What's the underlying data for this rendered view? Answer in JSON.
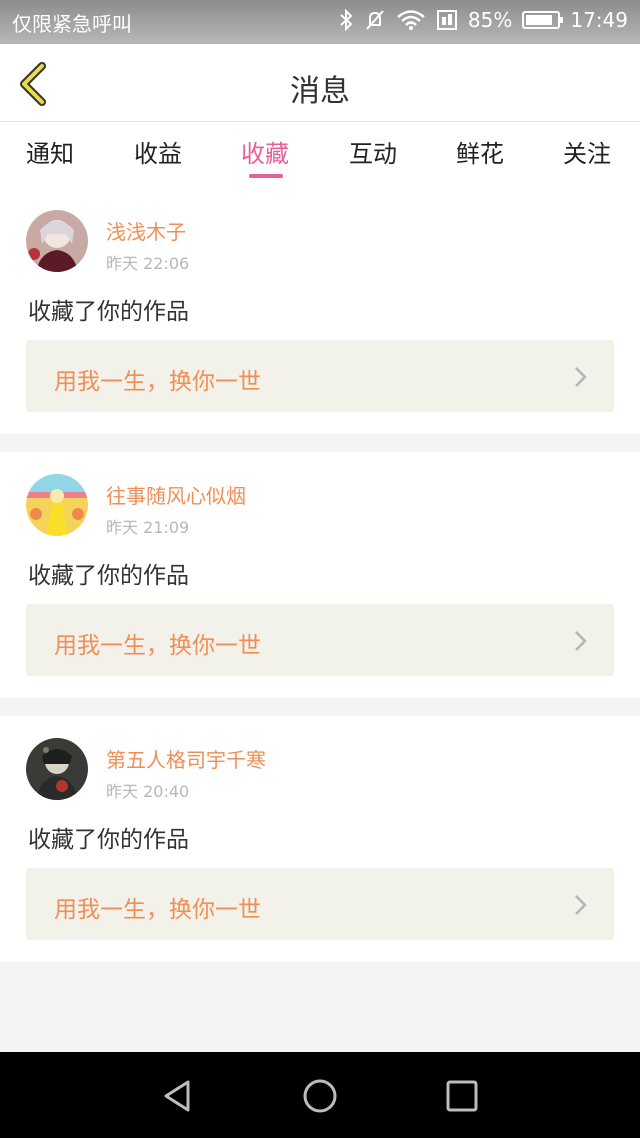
{
  "status_bar": {
    "carrier": "仅限紧急呼叫",
    "battery_percent": "85%",
    "battery_level": 0.85,
    "time": "17:49"
  },
  "header": {
    "title": "消息",
    "back_icon": "chevron-left-icon"
  },
  "tabs": [
    {
      "label": "通知",
      "active": false
    },
    {
      "label": "收益",
      "active": false
    },
    {
      "label": "收藏",
      "active": true
    },
    {
      "label": "互动",
      "active": false
    },
    {
      "label": "鲜花",
      "active": false
    },
    {
      "label": "关注",
      "active": false
    }
  ],
  "messages": [
    {
      "username": "浅浅木子",
      "time": "昨天 22:06",
      "action": "收藏了你的作品",
      "work_title": "用我一生，换你一世"
    },
    {
      "username": "往事随风心似烟",
      "time": "昨天 21:09",
      "action": "收藏了你的作品",
      "work_title": "用我一生，换你一世"
    },
    {
      "username": "第五人格司宇千寒",
      "time": "昨天 20:40",
      "action": "收藏了你的作品",
      "work_title": "用我一生，换你一世"
    }
  ],
  "colors": {
    "accent_pink": "#e8609b",
    "name_orange": "#ef8f57",
    "work_box_bg": "#f3f2ea"
  },
  "nav": [
    "back-triangle-icon",
    "home-circle-icon",
    "recents-square-icon"
  ]
}
